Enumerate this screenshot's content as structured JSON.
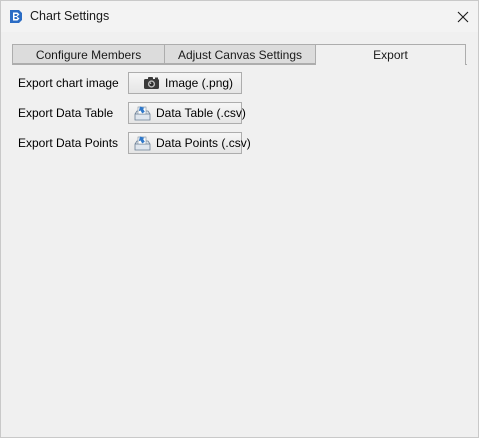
{
  "window": {
    "title": "Chart Settings",
    "app_icon": "app-logo-icon",
    "close_icon": "close-icon"
  },
  "tabs": [
    {
      "label": "Configure Members",
      "selected": false
    },
    {
      "label": "Adjust Canvas Settings",
      "selected": false
    },
    {
      "label": "Export",
      "selected": true
    }
  ],
  "export": {
    "rows": [
      {
        "label": "Export chart image",
        "button_label": "Image (.png)",
        "icon": "camera-icon"
      },
      {
        "label": "Export Data Table",
        "button_label": "Data Table (.csv)",
        "icon": "export-file-icon"
      },
      {
        "label": "Export Data Points",
        "button_label": "Data Points (.csv)",
        "icon": "export-file-icon"
      }
    ]
  },
  "colors": {
    "window_bg": "#f0f0f0",
    "tab_inactive": "#dcdcdc",
    "tab_border": "#adadad",
    "app_icon_blue": "#2b6cc4"
  }
}
